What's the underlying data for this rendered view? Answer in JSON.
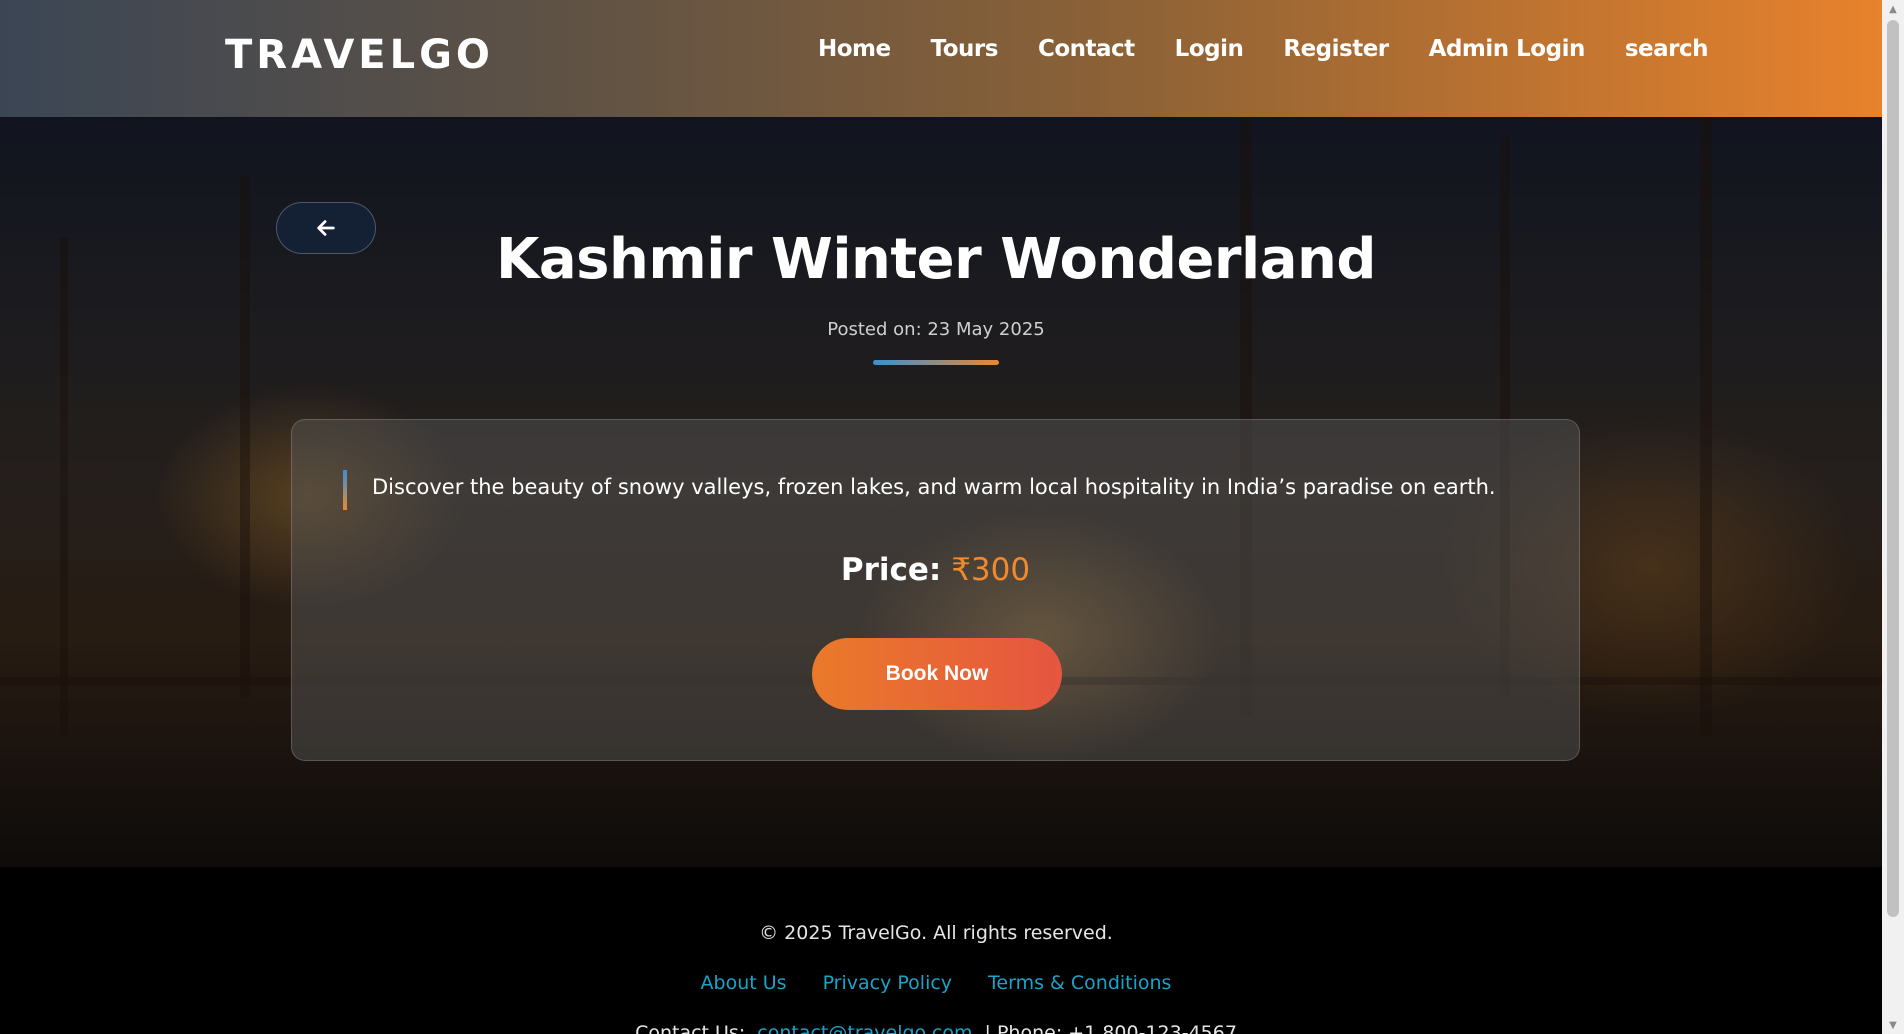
{
  "header": {
    "logo": "TRAVELGO",
    "nav": [
      "Home",
      "Tours",
      "Contact",
      "Login",
      "Register",
      "Admin Login",
      "search"
    ]
  },
  "tour": {
    "title": "Kashmir Winter Wonderland",
    "posted": "Posted on: 23 May 2025",
    "description": "Discover the beauty of snowy valleys, frozen lakes, and warm local hospitality in India’s paradise on earth.",
    "price_label": "Price:",
    "price_value": "₹300",
    "book_label": "Book Now"
  },
  "footer": {
    "copyright": "© 2025 TravelGo. All rights reserved.",
    "links": [
      "About Us",
      "Privacy Policy",
      "Terms & Conditions"
    ],
    "contact_label": "Contact Us:",
    "contact_email": "contact@travelgo.com",
    "phone_text": "| Phone: +1 800-123-4567"
  },
  "icons": {
    "back": "arrow-left-icon"
  },
  "colors": {
    "accent": "#e8822c",
    "price": "#f08a2c",
    "link": "#1aa3c9",
    "back_button": "#142033"
  }
}
